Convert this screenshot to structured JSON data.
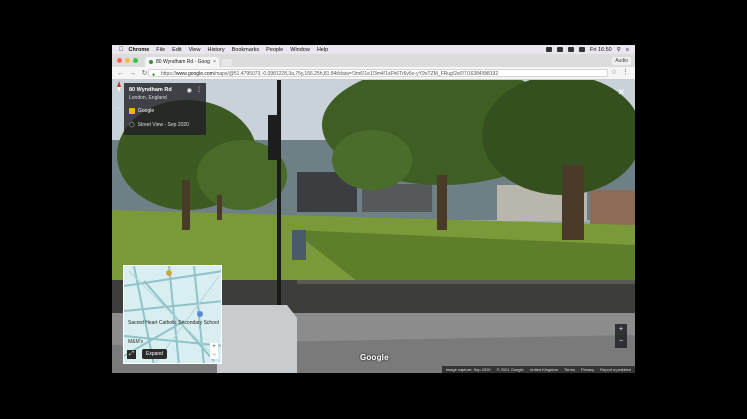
{
  "menubar": {
    "app": "Chrome",
    "items": [
      "File",
      "Edit",
      "View",
      "History",
      "Bookmarks",
      "People",
      "Window",
      "Help"
    ],
    "clock": "Fri 16:50"
  },
  "tab": {
    "title": "80 Wyndham Rd - Goog",
    "close": "×"
  },
  "profile": "Audio",
  "address_bar": {
    "scheme": "https://",
    "host": "www.google.com",
    "path": "/maps/@51.4795073,-0.0981228,3a,75y,166.25h,81.84t/data=!3m6!1e1!3m4!1sFh6Tr6v5o-yY9oTZM_FRug!2e0!7i16384!8i8192"
  },
  "streetview": {
    "address": "80 Wyndham Rd",
    "city": "London, England",
    "brand": "Google",
    "capture": "Street View - Sep 2020",
    "watermark": "Google",
    "minimap": {
      "expand_label": "Expand",
      "school_label": "Sacred Heart Catholic Secondary School",
      "mf_label": "M&M's"
    },
    "attribution": [
      "Image capture: Sep 2020",
      "© 2021 Google",
      "United Kingdom",
      "Terms",
      "Privacy",
      "Report a problem"
    ]
  },
  "colors": {
    "sky": "#c8d2d8",
    "grass": "#7a9a3a",
    "tree": "#3d5a22",
    "wall": "#3d3d3a",
    "road": "#8c8c8c"
  }
}
